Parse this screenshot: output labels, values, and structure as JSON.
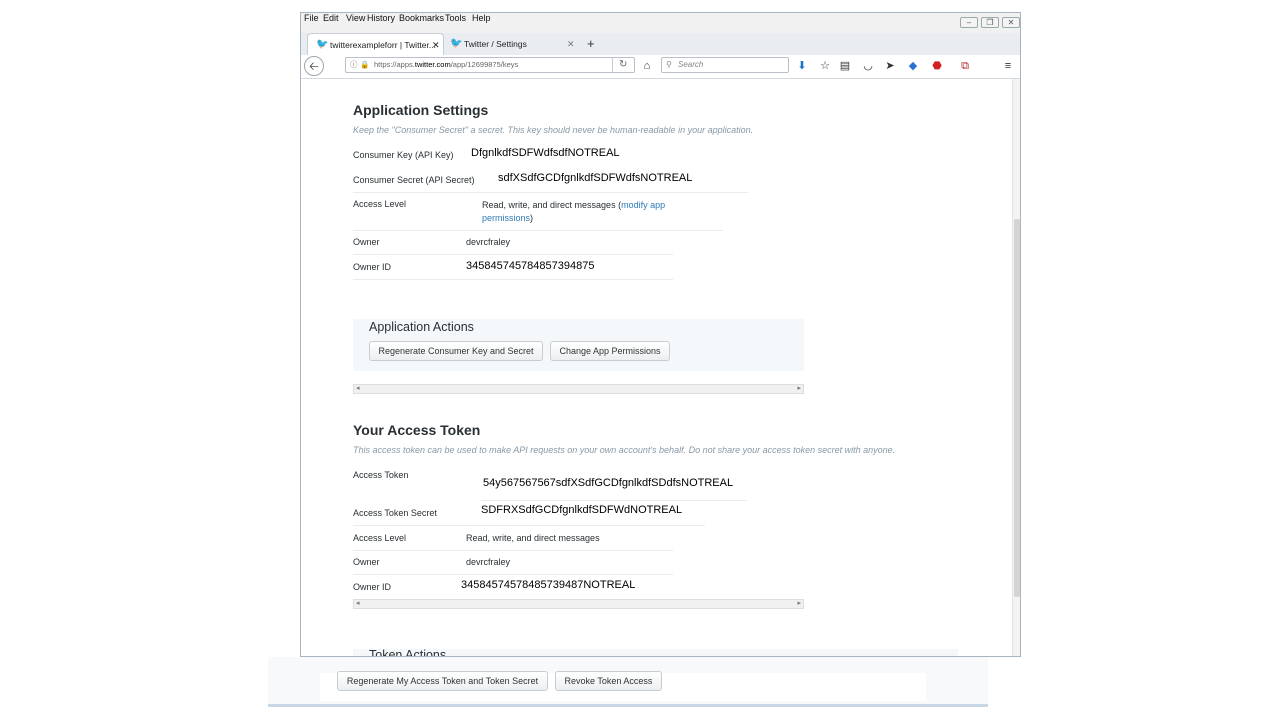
{
  "menu": [
    "File",
    "Edit",
    "View",
    "History",
    "Bookmarks",
    "Tools",
    "Help"
  ],
  "tabs": [
    {
      "title": "twitterexampleforr | Twitter..."
    },
    {
      "title": "Twitter / Settings"
    }
  ],
  "url": {
    "prefix": "https://apps.",
    "domain": "twitter.com",
    "path": "/app/12699875/keys"
  },
  "search": {
    "placeholder": "Search"
  },
  "app_settings": {
    "title": "Application Settings",
    "subtitle": "Keep the \"Consumer Secret\" a secret. This key should never be human-readable in your application.",
    "consumer_key_label": "Consumer Key (API Key)",
    "consumer_key": "DfgnlkdfSDFWdfsdfNOTREAL",
    "consumer_secret_label": "Consumer Secret (API Secret)",
    "consumer_secret": "sdfXSdfGCDfgnlkdfSDFWdfsNOTREAL",
    "access_level_label": "Access Level",
    "access_level_text": "Read, write, and direct messages (",
    "modify_link": "modify app permissions",
    "access_level_close": ")",
    "owner_label": "Owner",
    "owner": "devrcfraley",
    "owner_id_label": "Owner ID",
    "owner_id": "345845745784857394875"
  },
  "app_actions": {
    "title": "Application Actions",
    "regenerate": "Regenerate Consumer Key and Secret",
    "change_permissions": "Change App Permissions"
  },
  "access_token": {
    "title": "Your Access Token",
    "subtitle": "This access token can be used to make API requests on your own account's behalf. Do not share your access token secret with anyone.",
    "token_label": "Access Token",
    "token": "54y567567567sdfXSdfGCDfgnlkdfSDdfsNOTREAL",
    "secret_label": "Access Token Secret",
    "secret": "SDFRXSdfGCDfgnlkdfSDFWdNOTREAL",
    "level_label": "Access Level",
    "level": "Read, write, and direct messages",
    "owner_label": "Owner",
    "owner": "devrcfraley",
    "owner_id_label": "Owner ID",
    "owner_id": "34584574578485739487NOTREAL"
  },
  "token_actions": {
    "title": "Token Actions",
    "regenerate": "Regenerate My Access Token and Token Secret",
    "revoke": "Revoke Token Access"
  }
}
